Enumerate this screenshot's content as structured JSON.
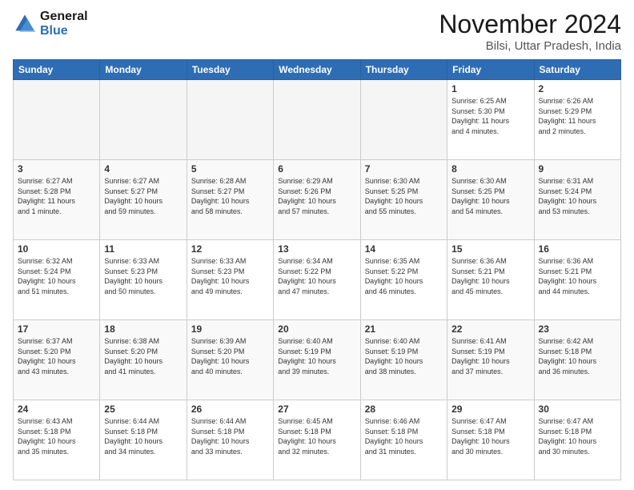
{
  "header": {
    "logo_line1": "General",
    "logo_line2": "Blue",
    "month_title": "November 2024",
    "subtitle": "Bilsi, Uttar Pradesh, India"
  },
  "weekdays": [
    "Sunday",
    "Monday",
    "Tuesday",
    "Wednesday",
    "Thursday",
    "Friday",
    "Saturday"
  ],
  "weeks": [
    [
      {
        "day": "",
        "info": ""
      },
      {
        "day": "",
        "info": ""
      },
      {
        "day": "",
        "info": ""
      },
      {
        "day": "",
        "info": ""
      },
      {
        "day": "",
        "info": ""
      },
      {
        "day": "1",
        "info": "Sunrise: 6:25 AM\nSunset: 5:30 PM\nDaylight: 11 hours\nand 4 minutes."
      },
      {
        "day": "2",
        "info": "Sunrise: 6:26 AM\nSunset: 5:29 PM\nDaylight: 11 hours\nand 2 minutes."
      }
    ],
    [
      {
        "day": "3",
        "info": "Sunrise: 6:27 AM\nSunset: 5:28 PM\nDaylight: 11 hours\nand 1 minute."
      },
      {
        "day": "4",
        "info": "Sunrise: 6:27 AM\nSunset: 5:27 PM\nDaylight: 10 hours\nand 59 minutes."
      },
      {
        "day": "5",
        "info": "Sunrise: 6:28 AM\nSunset: 5:27 PM\nDaylight: 10 hours\nand 58 minutes."
      },
      {
        "day": "6",
        "info": "Sunrise: 6:29 AM\nSunset: 5:26 PM\nDaylight: 10 hours\nand 57 minutes."
      },
      {
        "day": "7",
        "info": "Sunrise: 6:30 AM\nSunset: 5:25 PM\nDaylight: 10 hours\nand 55 minutes."
      },
      {
        "day": "8",
        "info": "Sunrise: 6:30 AM\nSunset: 5:25 PM\nDaylight: 10 hours\nand 54 minutes."
      },
      {
        "day": "9",
        "info": "Sunrise: 6:31 AM\nSunset: 5:24 PM\nDaylight: 10 hours\nand 53 minutes."
      }
    ],
    [
      {
        "day": "10",
        "info": "Sunrise: 6:32 AM\nSunset: 5:24 PM\nDaylight: 10 hours\nand 51 minutes."
      },
      {
        "day": "11",
        "info": "Sunrise: 6:33 AM\nSunset: 5:23 PM\nDaylight: 10 hours\nand 50 minutes."
      },
      {
        "day": "12",
        "info": "Sunrise: 6:33 AM\nSunset: 5:23 PM\nDaylight: 10 hours\nand 49 minutes."
      },
      {
        "day": "13",
        "info": "Sunrise: 6:34 AM\nSunset: 5:22 PM\nDaylight: 10 hours\nand 47 minutes."
      },
      {
        "day": "14",
        "info": "Sunrise: 6:35 AM\nSunset: 5:22 PM\nDaylight: 10 hours\nand 46 minutes."
      },
      {
        "day": "15",
        "info": "Sunrise: 6:36 AM\nSunset: 5:21 PM\nDaylight: 10 hours\nand 45 minutes."
      },
      {
        "day": "16",
        "info": "Sunrise: 6:36 AM\nSunset: 5:21 PM\nDaylight: 10 hours\nand 44 minutes."
      }
    ],
    [
      {
        "day": "17",
        "info": "Sunrise: 6:37 AM\nSunset: 5:20 PM\nDaylight: 10 hours\nand 43 minutes."
      },
      {
        "day": "18",
        "info": "Sunrise: 6:38 AM\nSunset: 5:20 PM\nDaylight: 10 hours\nand 41 minutes."
      },
      {
        "day": "19",
        "info": "Sunrise: 6:39 AM\nSunset: 5:20 PM\nDaylight: 10 hours\nand 40 minutes."
      },
      {
        "day": "20",
        "info": "Sunrise: 6:40 AM\nSunset: 5:19 PM\nDaylight: 10 hours\nand 39 minutes."
      },
      {
        "day": "21",
        "info": "Sunrise: 6:40 AM\nSunset: 5:19 PM\nDaylight: 10 hours\nand 38 minutes."
      },
      {
        "day": "22",
        "info": "Sunrise: 6:41 AM\nSunset: 5:19 PM\nDaylight: 10 hours\nand 37 minutes."
      },
      {
        "day": "23",
        "info": "Sunrise: 6:42 AM\nSunset: 5:18 PM\nDaylight: 10 hours\nand 36 minutes."
      }
    ],
    [
      {
        "day": "24",
        "info": "Sunrise: 6:43 AM\nSunset: 5:18 PM\nDaylight: 10 hours\nand 35 minutes."
      },
      {
        "day": "25",
        "info": "Sunrise: 6:44 AM\nSunset: 5:18 PM\nDaylight: 10 hours\nand 34 minutes."
      },
      {
        "day": "26",
        "info": "Sunrise: 6:44 AM\nSunset: 5:18 PM\nDaylight: 10 hours\nand 33 minutes."
      },
      {
        "day": "27",
        "info": "Sunrise: 6:45 AM\nSunset: 5:18 PM\nDaylight: 10 hours\nand 32 minutes."
      },
      {
        "day": "28",
        "info": "Sunrise: 6:46 AM\nSunset: 5:18 PM\nDaylight: 10 hours\nand 31 minutes."
      },
      {
        "day": "29",
        "info": "Sunrise: 6:47 AM\nSunset: 5:18 PM\nDaylight: 10 hours\nand 30 minutes."
      },
      {
        "day": "30",
        "info": "Sunrise: 6:47 AM\nSunset: 5:18 PM\nDaylight: 10 hours\nand 30 minutes."
      }
    ]
  ]
}
